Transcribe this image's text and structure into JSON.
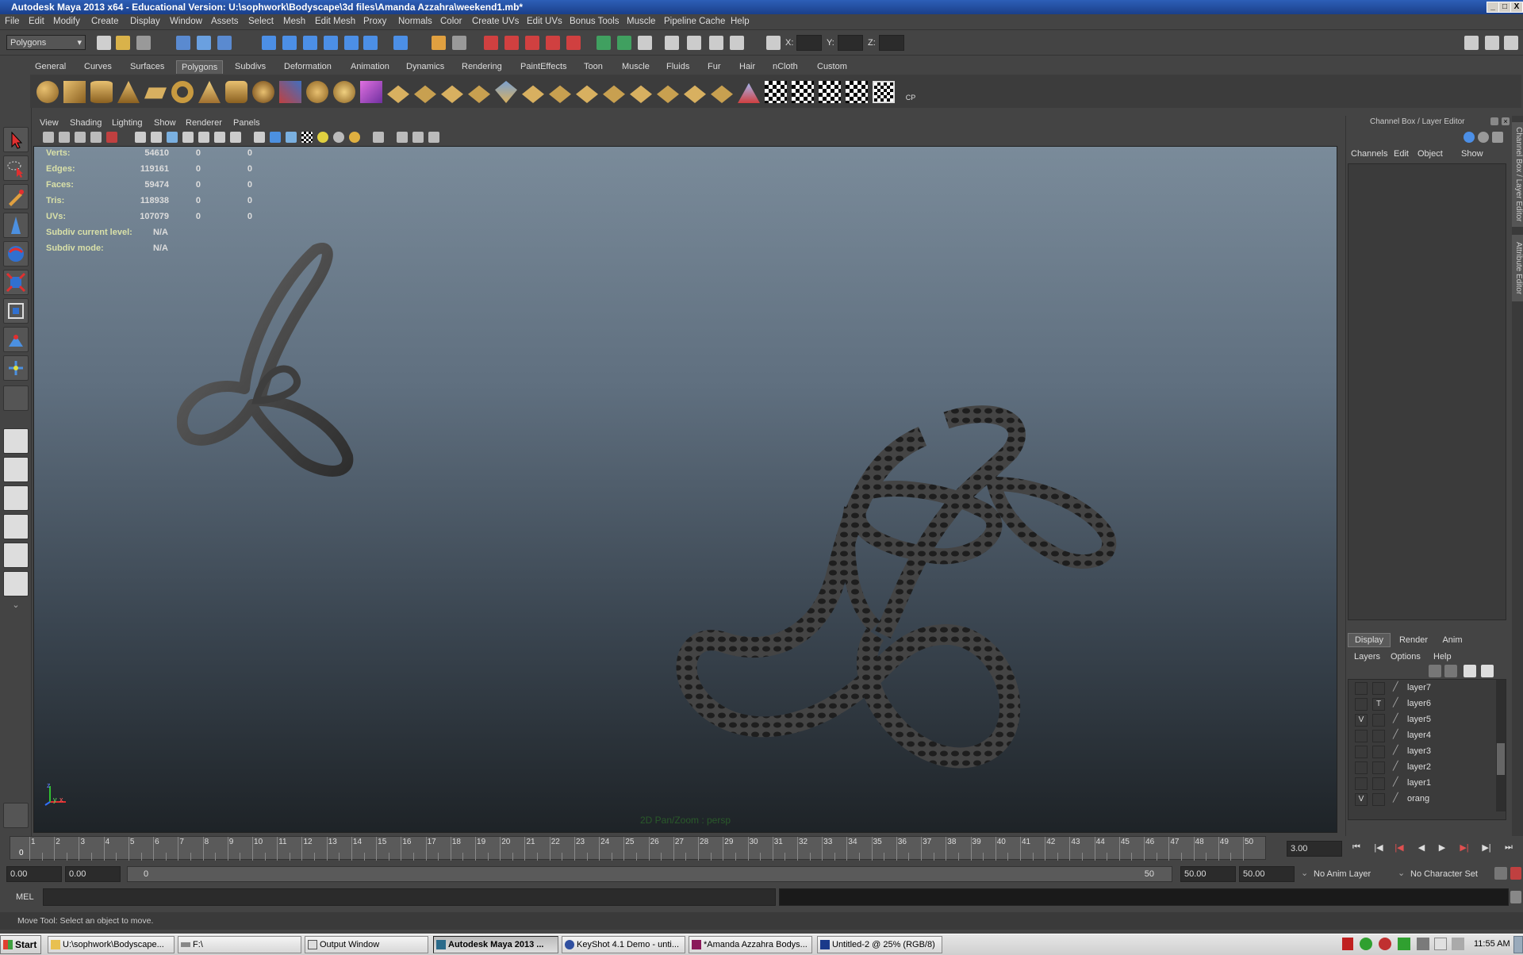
{
  "window": {
    "title": "Autodesk Maya 2013 x64 - Educational Version: U:\\sophwork\\Bodyscape\\3d files\\Amanda Azzahra\\weekend1.mb*",
    "controls": [
      "_",
      "□",
      "X"
    ]
  },
  "menubar": {
    "items": [
      "File",
      "Edit",
      "Modify",
      "Create",
      "Display",
      "Window",
      "Assets",
      "Select",
      "Mesh",
      "Edit Mesh",
      "Proxy",
      "Normals",
      "Color",
      "Create UVs",
      "Edit UVs",
      "Bonus Tools",
      "Muscle",
      "Pipeline Cache",
      "Help"
    ]
  },
  "statusline": {
    "mode_select": "Polygons",
    "coord_labels": [
      "X:",
      "Y:",
      "Z:"
    ]
  },
  "shelf": {
    "tabs": [
      "General",
      "Curves",
      "Surfaces",
      "Polygons",
      "Subdivs",
      "Deformation",
      "Animation",
      "Dynamics",
      "Rendering",
      "PaintEffects",
      "Toon",
      "Muscle",
      "Fluids",
      "Fur",
      "Hair",
      "nCloth",
      "Custom"
    ],
    "active_tab": "Polygons",
    "last_icon_label": "CP"
  },
  "panel": {
    "menus": [
      "View",
      "Shading",
      "Lighting",
      "Show",
      "Renderer",
      "Panels"
    ],
    "view_label": "2D Pan/Zoom : persp",
    "axis_labels": [
      "z",
      "y",
      "x"
    ]
  },
  "hud": {
    "rows": [
      {
        "label": "Verts:",
        "v1": "54610",
        "v2": "0",
        "v3": "0"
      },
      {
        "label": "Edges:",
        "v1": "119161",
        "v2": "0",
        "v3": "0"
      },
      {
        "label": "Faces:",
        "v1": "59474",
        "v2": "0",
        "v3": "0"
      },
      {
        "label": "Tris:",
        "v1": "118938",
        "v2": "0",
        "v3": "0"
      },
      {
        "label": "UVs:",
        "v1": "107079",
        "v2": "0",
        "v3": "0"
      }
    ],
    "subdiv_level_label": "Subdiv current level:",
    "subdiv_level_value": "N/A",
    "subdiv_mode_label": "Subdiv mode:",
    "subdiv_mode_value": "N/A"
  },
  "channelbox": {
    "title": "Channel Box / Layer Editor",
    "menus": [
      "Channels",
      "Edit",
      "Object",
      "Show"
    ],
    "side_tabs": [
      "Channel Box / Layer Editor",
      "Attribute Editor"
    ]
  },
  "layereditor": {
    "tabs": [
      "Display",
      "Render",
      "Anim"
    ],
    "active_tab": "Display",
    "menus": [
      "Layers",
      "Options",
      "Help"
    ],
    "layers": [
      {
        "v": "",
        "t": "",
        "name": "layer7"
      },
      {
        "v": "",
        "t": "T",
        "name": "layer6"
      },
      {
        "v": "V",
        "t": "",
        "name": "layer5"
      },
      {
        "v": "",
        "t": "",
        "name": "layer4"
      },
      {
        "v": "",
        "t": "",
        "name": "layer3"
      },
      {
        "v": "",
        "t": "",
        "name": "layer2"
      },
      {
        "v": "",
        "t": "",
        "name": "layer1"
      },
      {
        "v": "V",
        "t": "",
        "name": "orang"
      }
    ]
  },
  "timeslider": {
    "ticks": [
      "1",
      "2",
      "3",
      "4",
      "5",
      "6",
      "7",
      "8",
      "9",
      "10",
      "11",
      "12",
      "13",
      "14",
      "15",
      "16",
      "17",
      "18",
      "19",
      "20",
      "21",
      "22",
      "23",
      "24",
      "25",
      "26",
      "27",
      "28",
      "29",
      "30",
      "31",
      "32",
      "33",
      "34",
      "35",
      "36",
      "37",
      "38",
      "39",
      "40",
      "41",
      "42",
      "43",
      "44",
      "45",
      "46",
      "47",
      "48",
      "49",
      "50"
    ],
    "current_frame_marker": "0",
    "current_time": "3.00"
  },
  "rangeslider": {
    "start_time": "0.00",
    "playback_start": "0.00",
    "range_start": "0",
    "range_end": "50",
    "playback_end": "50.00",
    "end_time": "50.00",
    "anim_layer": "No Anim Layer",
    "character_set": "No Character Set"
  },
  "cmdline": {
    "label": "MEL"
  },
  "helpline": {
    "text": "Move Tool: Select an object to move."
  },
  "taskbar": {
    "start_label": "Start",
    "tasks": [
      "U:\\sophwork\\Bodyscape...",
      "F:\\",
      "Output Window",
      "Autodesk Maya 2013 ...",
      "KeyShot 4.1 Demo  - unti...",
      "*Amanda Azzahra Bodys...",
      "Untitled-2 @ 25% (RGB/8)"
    ],
    "active_task_index": 3,
    "clock": "11:55 AM"
  }
}
